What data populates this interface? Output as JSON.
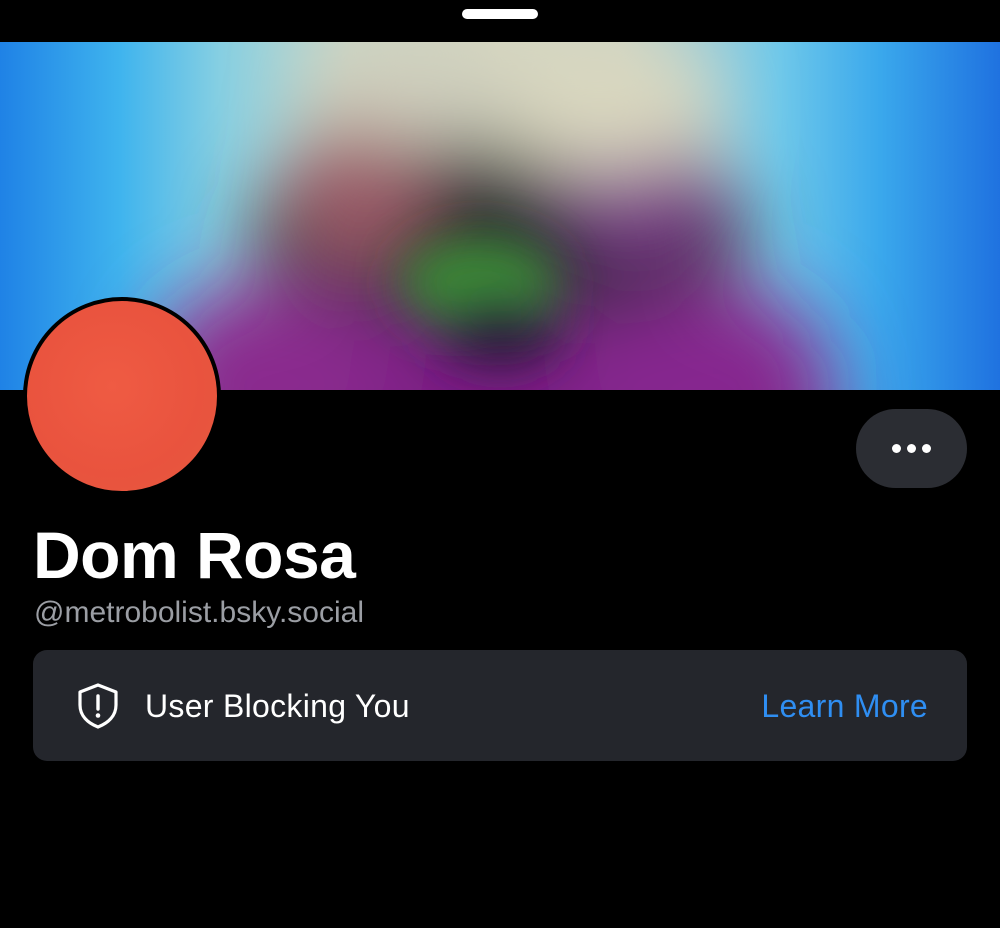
{
  "profile": {
    "display_name": "Dom Rosa",
    "handle": "@metrobolist.bsky.social"
  },
  "alert": {
    "icon": "shield-exclamation-icon",
    "text": "User Blocking You",
    "action_label": "Learn More"
  },
  "icons": {
    "more": "ellipsis-icon",
    "grabber": "sheet-grabber"
  },
  "colors": {
    "background": "#000000",
    "surface": "#24262c",
    "button": "#2b2d33",
    "accent": "#2f8ef2",
    "muted_text": "#9b9ea4",
    "avatar": "#e9533e"
  }
}
